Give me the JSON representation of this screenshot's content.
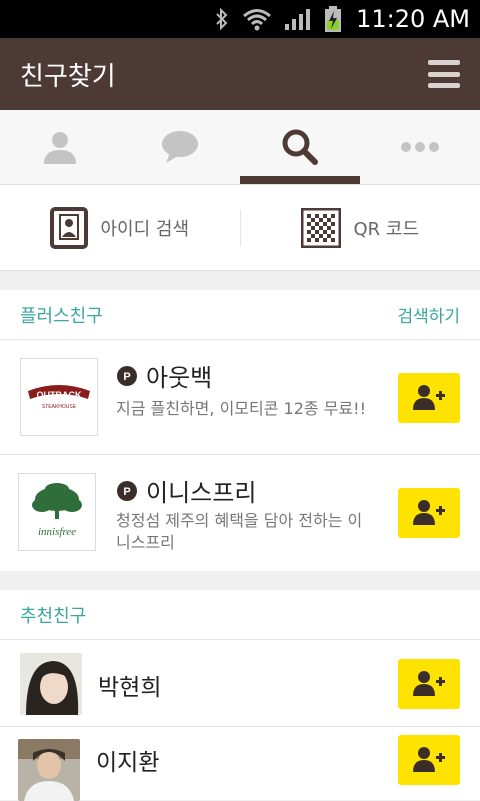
{
  "status_bar": {
    "time": "11:20 AM",
    "icons": [
      "bluetooth-icon",
      "wifi-icon",
      "signal-icon",
      "battery-charging-icon"
    ]
  },
  "app_bar": {
    "title": "친구찾기",
    "menu_icon": "hamburger-menu-icon"
  },
  "tabs": [
    {
      "icon": "friends-icon",
      "active": false
    },
    {
      "icon": "chat-icon",
      "active": false
    },
    {
      "icon": "search-icon",
      "active": true
    },
    {
      "icon": "more-icon",
      "active": false
    }
  ],
  "search_options": {
    "id_search": "아이디 검색",
    "qr_code": "QR 코드"
  },
  "plus_friends": {
    "title": "플러스친구",
    "action": "검색하기",
    "items": [
      {
        "name": "아웃백",
        "description": "지금 플친하면, 이모티콘 12종 무료!!",
        "logo_text": "OUTBACK",
        "logo_sub": "STEAKHOUSE"
      },
      {
        "name": "이니스프리",
        "description": "청정섬 제주의 혜택을 담아 전하는 이니스프리",
        "logo_text": "innisfree"
      }
    ]
  },
  "recommended": {
    "title": "추천친구",
    "items": [
      {
        "name": "박현희"
      },
      {
        "name": "이지환"
      }
    ]
  },
  "colors": {
    "app_bar": "#4e3a35",
    "accent": "#3aa6a0",
    "add_button": "#ffe300"
  }
}
